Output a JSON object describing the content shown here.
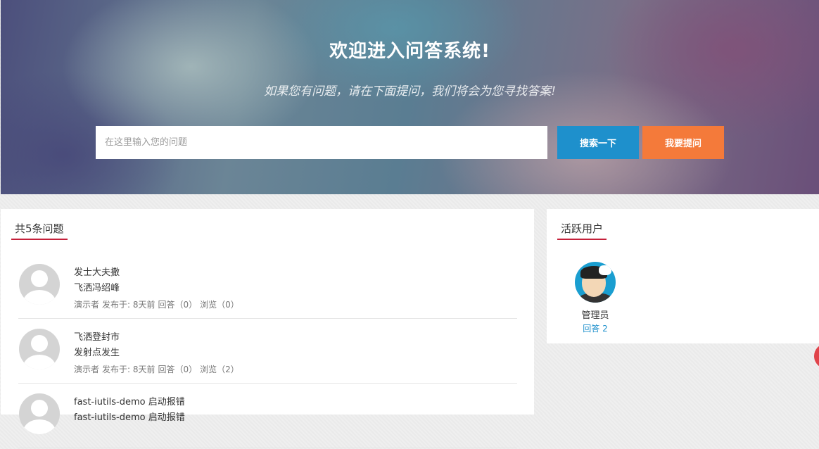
{
  "hero": {
    "title": "欢迎进入问答系统!",
    "subtitle": "如果您有问题，请在下面提问，我们将会为您寻找答案!",
    "search_placeholder": "在这里输入您的问题",
    "search_button": "搜索一下",
    "ask_button": "我要提问"
  },
  "questions": {
    "heading": "共5条问题",
    "items": [
      {
        "title": "发士大夫撒",
        "description": "飞洒冯绍峰",
        "author": "演示者",
        "published": "发布于: 8天前",
        "answers": "回答（0）",
        "views": "浏览（0）"
      },
      {
        "title": "飞洒登封市",
        "description": "发射点发生",
        "author": "演示者",
        "published": "发布于: 8天前",
        "answers": "回答（0）",
        "views": "浏览（2）"
      },
      {
        "title": "fast-iutils-demo 启动报错",
        "description": "fast-iutils-demo 启动报错",
        "author": "",
        "published": "",
        "answers": "",
        "views": ""
      }
    ]
  },
  "active_users": {
    "heading": "活跃用户",
    "users": [
      {
        "name": "管理员",
        "answers": "回答 2"
      }
    ]
  },
  "colors": {
    "accent_red": "#c5203a",
    "search_blue": "#1e90cc",
    "ask_orange": "#f47a3a"
  }
}
